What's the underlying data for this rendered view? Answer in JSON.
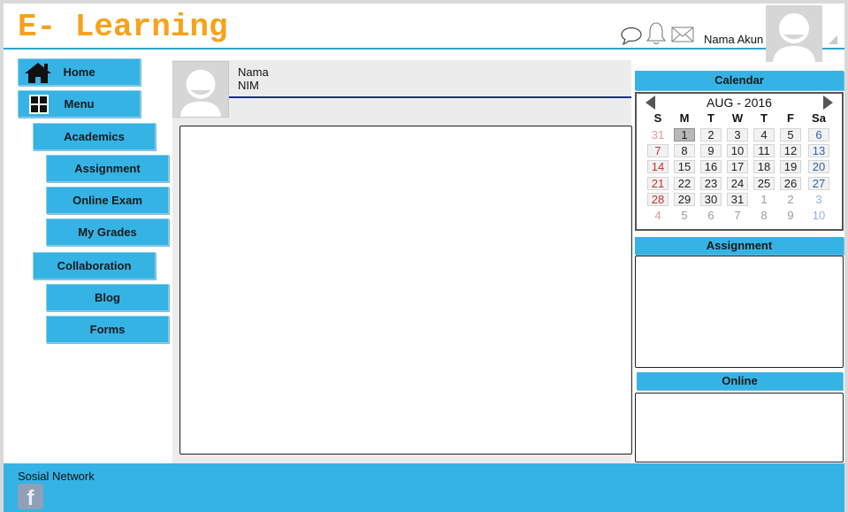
{
  "header": {
    "brand": "E- Learning",
    "account_name": "Nama Akun",
    "icons": [
      "chat-bubble-icon",
      "bell-icon",
      "mail-icon"
    ]
  },
  "sidebar": {
    "home": "Home",
    "menu": "Menu",
    "academics": "Academics",
    "assignment": "Assignment",
    "online_exam": "Online Exam",
    "my_grades": "My Grades",
    "collaboration": "Collaboration",
    "blog": "Blog",
    "forms": "Forms"
  },
  "profile": {
    "name": "Nama",
    "nim": "NIM"
  },
  "calendar": {
    "heading": "Calendar",
    "month_label": "AUG - 2016",
    "weekdays": [
      "S",
      "M",
      "T",
      "W",
      "T",
      "F",
      "Sa"
    ],
    "weeks": [
      [
        "31",
        "1",
        "2",
        "3",
        "4",
        "5",
        "6"
      ],
      [
        "7",
        "8",
        "9",
        "10",
        "11",
        "12",
        "13"
      ],
      [
        "14",
        "15",
        "16",
        "17",
        "18",
        "19",
        "20"
      ],
      [
        "21",
        "22",
        "23",
        "24",
        "25",
        "26",
        "27"
      ],
      [
        "28",
        "29",
        "30",
        "31",
        "1",
        "2",
        "3"
      ],
      [
        "4",
        "5",
        "6",
        "7",
        "8",
        "9",
        "10"
      ]
    ],
    "selected_day": "1"
  },
  "assignment_panel": {
    "heading": "Assignment"
  },
  "online_panel": {
    "heading": "Online"
  },
  "footer": {
    "label": "Sosial Network",
    "facebook_glyph": "f"
  },
  "colors": {
    "brand": "#f7a21b",
    "accent": "#35b3e5",
    "sunday": "#c8322e",
    "saturday": "#2f5fb3"
  }
}
